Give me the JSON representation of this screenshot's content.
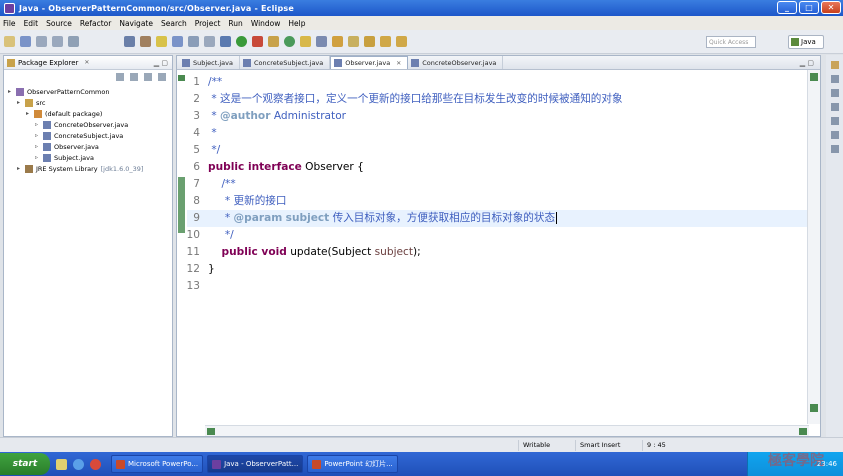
{
  "window": {
    "title": "Java - ObserverPatternCommon/src/Observer.java - Eclipse"
  },
  "menu": [
    "File",
    "Edit",
    "Source",
    "Refactor",
    "Navigate",
    "Search",
    "Project",
    "Run",
    "Window",
    "Help"
  ],
  "toolbar": {
    "quick_access_placeholder": "Quick Access",
    "perspective": "Java"
  },
  "package_explorer": {
    "title": "Package Explorer",
    "tree": [
      {
        "label": "ObserverPatternCommon",
        "depth": 0
      },
      {
        "label": "src",
        "depth": 1
      },
      {
        "label": "(default package)",
        "depth": 2
      },
      {
        "label": "ConcreteObserver.java",
        "depth": 3
      },
      {
        "label": "ConcreteSubject.java",
        "depth": 3
      },
      {
        "label": "Observer.java",
        "depth": 3
      },
      {
        "label": "Subject.java",
        "depth": 3
      },
      {
        "label": "JRE System Library",
        "depth": 1,
        "suffix": "[jdk1.6.0_39]"
      }
    ]
  },
  "editor": {
    "tabs": [
      "Subject.java",
      "ConcreteSubject.java",
      "Observer.java",
      "ConcreteObserver.java"
    ],
    "active_tab": 2,
    "current_line": 9,
    "lines": [
      {
        "n": "1",
        "parts": [
          {
            "t": "/**",
            "c": "cm"
          }
        ]
      },
      {
        "n": "2",
        "parts": [
          {
            "t": " * 这是一个观察者接口，定义一个更新的接口给那些在目标发生改变的时候被通知的对象",
            "c": "cm"
          }
        ]
      },
      {
        "n": "3",
        "parts": [
          {
            "t": " * ",
            "c": "cm"
          },
          {
            "t": "@author",
            "c": "tag"
          },
          {
            "t": " Administrator",
            "c": "cm"
          }
        ]
      },
      {
        "n": "4",
        "parts": [
          {
            "t": " *",
            "c": "cm"
          }
        ]
      },
      {
        "n": "5",
        "parts": [
          {
            "t": " */",
            "c": "cm"
          }
        ]
      },
      {
        "n": "6",
        "parts": [
          {
            "t": "public interface",
            "c": "kw"
          },
          {
            "t": " Observer {",
            "c": "pl"
          }
        ]
      },
      {
        "n": "7",
        "parts": [
          {
            "t": "    /**",
            "c": "cm"
          }
        ]
      },
      {
        "n": "8",
        "parts": [
          {
            "t": "     * 更新的接口",
            "c": "cm"
          }
        ]
      },
      {
        "n": "9",
        "parts": [
          {
            "t": "     * ",
            "c": "cm"
          },
          {
            "t": "@param",
            "c": "tag"
          },
          {
            "t": " ",
            "c": "cm"
          },
          {
            "t": "subject",
            "c": "tag"
          },
          {
            "t": " 传入目标对象，方便获取相应的目标对象的状态",
            "c": "cm"
          }
        ]
      },
      {
        "n": "10",
        "parts": [
          {
            "t": "     */",
            "c": "cm"
          }
        ]
      },
      {
        "n": "11",
        "parts": [
          {
            "t": "    ",
            "c": "pl"
          },
          {
            "t": "public void",
            "c": "kw"
          },
          {
            "t": " update(Subject ",
            "c": "pl"
          },
          {
            "t": "subject",
            "c": "vr"
          },
          {
            "t": ");",
            "c": "pl"
          }
        ]
      },
      {
        "n": "12",
        "parts": [
          {
            "t": "}",
            "c": "pl"
          }
        ]
      },
      {
        "n": "13",
        "parts": []
      }
    ]
  },
  "status": {
    "mode": "Writable",
    "insert": "Smart Insert",
    "position": "9 : 45"
  },
  "taskbar": {
    "start": "start",
    "tasks": [
      "Microsoft PowerPo...",
      "Java - ObserverPatt...",
      "PowerPoint 幻灯片..."
    ],
    "active_task": 1,
    "clock": "23:46"
  },
  "colors": {
    "title_bar": "#1d57c9",
    "comment": "#3f5fbf",
    "keyword": "#7f0055",
    "javadoc_tag": "#7f9fbf",
    "current_line": "#e8f2fe"
  }
}
